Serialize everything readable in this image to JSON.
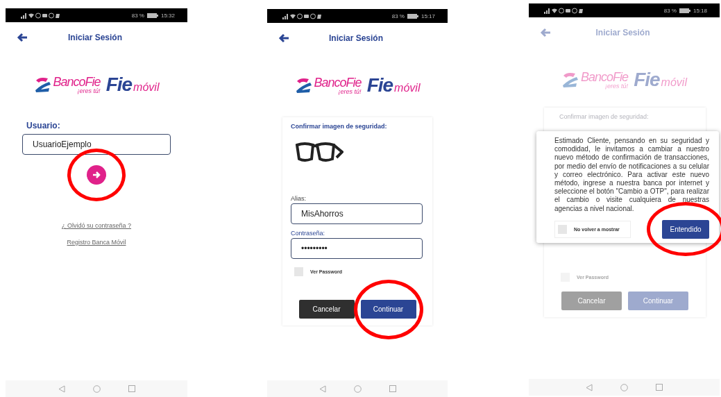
{
  "screens": [
    {
      "kind": "username",
      "status_bar": {
        "battery": "83 %",
        "time": "15:32"
      },
      "header": {
        "title": "Iniciar Sesión"
      },
      "logo": {
        "bank_first": "Banco",
        "bank_second": "Fie",
        "tagline": "¡eres tú!",
        "app_main": "Fie",
        "app_sub": "móvil"
      },
      "user_label": "Usuario:",
      "user_value": "UsuarioEjemplo",
      "next_highlighted": true,
      "links": [
        "¿ Olvidó su contraseña ?",
        "Registro Banca Móvil"
      ]
    },
    {
      "kind": "security",
      "status_bar": {
        "battery": "83 %",
        "time": "15:17"
      },
      "header": {
        "title": "Iniciar Sesión"
      },
      "logo": {
        "bank_first": "Banco",
        "bank_second": "Fie",
        "tagline": "¡eres tú!",
        "app_main": "Fie",
        "app_sub": "móvil"
      },
      "card_title": "Confirmar imagen de seguridad:",
      "alias_label": "Alias:",
      "alias_value": "MisAhorros",
      "password_label": "Contraseña:",
      "password_value": "•••••••••",
      "show_password": {
        "label": "Ver Password",
        "checked": false
      },
      "buttons": [
        {
          "kind": "cancel",
          "label": "Cancelar",
          "highlighted": false
        },
        {
          "kind": "primary",
          "label": "Continuar",
          "highlighted": true
        }
      ]
    },
    {
      "kind": "notice",
      "status_bar": {
        "battery": "83 %",
        "time": "15:18"
      },
      "header": {
        "title": "Iniciar Sesión"
      },
      "logo": {
        "bank_first": "Banco",
        "bank_second": "Fie",
        "tagline": "¡eres tú!",
        "app_main": "Fie",
        "app_sub": "móvil"
      },
      "card_title": "Confirmar imagen de seguridad:",
      "show_password": {
        "label": "Ver Password",
        "checked": false
      },
      "buttons": [
        {
          "kind": "cancel",
          "label": "Cancelar",
          "highlighted": false
        },
        {
          "kind": "primary",
          "label": "Continuar",
          "highlighted": false
        }
      ],
      "dialog": {
        "message": "Estimado Cliente, pensando en su seguridad y comodidad, le invitamos a cambiar a nuestro nuevo método de confirmación de transacciones, por medio del envío de notificaciones a su celular y correo electrónico. Para activar este nuevo método, ingrese a nuestra banca por internet y seleccione el botón \"Cambio a OTP\", para realizar el cambio o visite cualquiera de nuestras agencias a nivel nacional.",
        "dont_show": {
          "label": "No volver a mostrar",
          "checked": false
        },
        "button": {
          "label": "Entendido",
          "highlighted": true
        }
      }
    }
  ]
}
